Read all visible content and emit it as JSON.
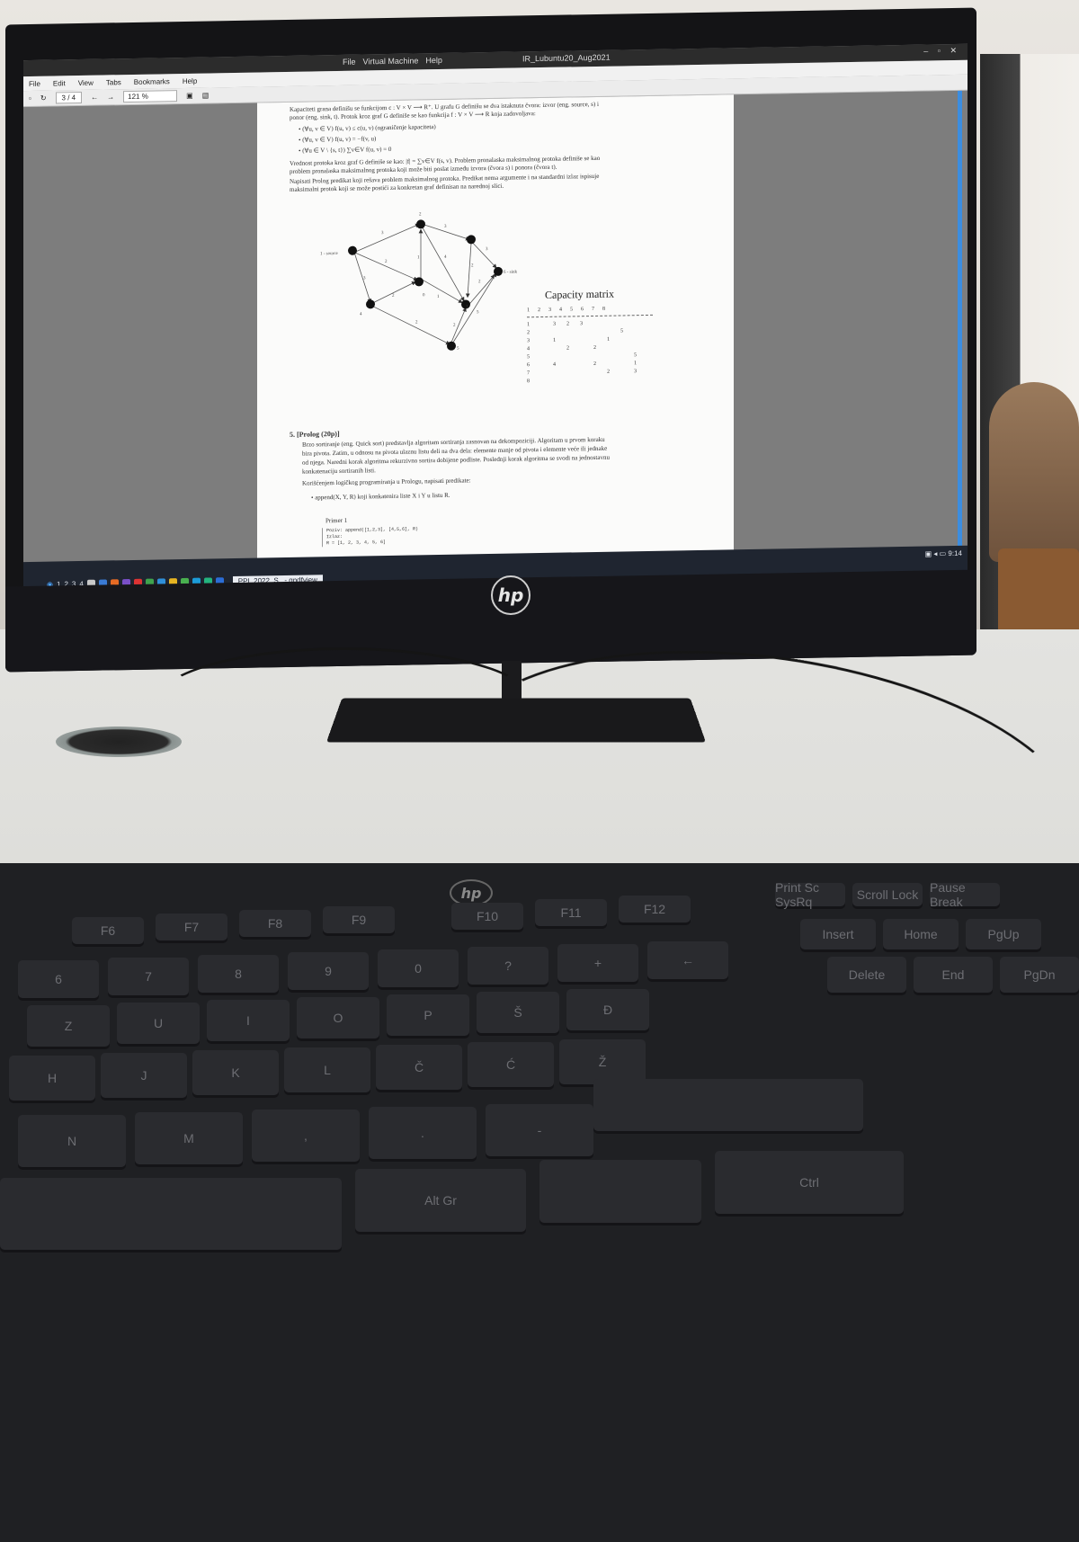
{
  "vm": {
    "menu": [
      "File",
      "Virtual Machine",
      "Help"
    ],
    "title": "IR_Lubuntu20_Aug2021"
  },
  "app": {
    "menu": [
      "File",
      "Edit",
      "View",
      "Tabs",
      "Bookmarks",
      "Help"
    ],
    "page_indicator": "3 / 4",
    "zoom": "121 %"
  },
  "document": {
    "intro_lines": [
      "Kapaciteti grana definišu se funkcijom c : V × V ⟶ R⁺. U grafu G definišu se dva istaknuta čvora: izvor (eng. source, s) i",
      "ponor (eng. sink, t). Protok kroz graf G definiše se kao funkcija f : V × V ⟶ R koja zadovoljava:"
    ],
    "bullets": [
      "(∀u, v ∈ V) f(u, v) ≤ c(u, v) (ograničenje kapaciteta)",
      "(∀u, v ∈ V) f(u, v) = −f(v, u)",
      "(∀u ∈ V \\ {s, t}) ∑v∈V f(u, v) = 0"
    ],
    "paragraph_lines": [
      "Vrednost protoka kroz graf G definiše se kao: |f| = ∑v∈V f(s, v). Problem pronalaska maksimalnog protoka definiše se kao",
      "problem pronalaska maksimalnog protoka koji može biti poslat između izvora (čvora s) i ponora (čvora t).",
      "Napisati Prolog predikat koji rešava problem maksimalnog protoka. Predikat nema argumente i na standardni izlaz ispisuje",
      "maksimalni protok koji se može postići za konkretan graf definisan na narednoj slici."
    ],
    "graph": {
      "source_label": "1 - source",
      "sink_label": "6 - sink",
      "edge_labels": [
        "3",
        "2",
        "3",
        "1",
        "2",
        "4",
        "3",
        "2",
        "0",
        "1",
        "4",
        "2",
        "1",
        "2",
        "5",
        "2",
        "3"
      ],
      "node_labels": [
        "2",
        "5"
      ]
    },
    "capacity_matrix": {
      "title": "Capacity matrix",
      "header": [
        "1",
        "2",
        "3",
        "4",
        "5",
        "6",
        "7",
        "8"
      ],
      "row_labels": [
        "1",
        "2",
        "3",
        "4",
        "5",
        "6",
        "7",
        "8"
      ],
      "rows": [
        [
          "",
          "3",
          "2",
          "3",
          "",
          "",
          "",
          ""
        ],
        [
          "",
          "",
          "",
          "",
          "",
          "",
          "5",
          ""
        ],
        [
          "",
          "1",
          "",
          "",
          "",
          "1",
          "",
          ""
        ],
        [
          "",
          "",
          "2",
          "",
          "2",
          "",
          "",
          ""
        ],
        [
          "",
          "",
          "",
          "",
          "",
          "",
          "",
          "5"
        ],
        [
          "",
          "4",
          "",
          "",
          "2",
          "",
          "",
          "1"
        ],
        [
          "",
          "",
          "",
          "",
          "",
          "2",
          "",
          "3"
        ],
        [
          "",
          "",
          "",
          "",
          "",
          "",
          "",
          ""
        ]
      ]
    },
    "section": {
      "heading": "5. [Prolog (20p)]",
      "lines": [
        "Brzo sortiranje (eng. Quick sort) predstavlja algoritam sortiranja zasnovan na dekompoziciji. Algoritam u prvom koraku",
        "bira pivota. Zatim, u odnosu na pivota ulaznu listu deli na dva dela: elemente manje od pivota i elemente veće ili jednake",
        "od njega. Naredni korak algoritma rekurzivno sortira dobijene podliste. Poslednji korak algoritma se svodi na jednostavnu",
        "konkatenaciju sortiranih listi."
      ],
      "task_line": "Korišćenjem logičkog programiranja u Prologu, napisati predikate:",
      "bullet": "append(X, Y, R) koji konkatenira liste X i Y u listu R.",
      "example_title": "Primer 1",
      "example_lines": [
        "Poziv: append([1,2,3], [4,5,6], R)",
        "Izlaz:",
        "R = [1, 2, 3, 4, 5, 6]"
      ]
    }
  },
  "taskbar": {
    "workspaces": [
      "1",
      "2",
      "3",
      "4"
    ],
    "active_window": "PPI_2022_S...- qpdfview",
    "clock": "9:14"
  },
  "keyboard": {
    "fkeys": [
      "F6",
      "F7",
      "F8",
      "F9",
      "F10",
      "F11",
      "F12"
    ],
    "system_keys": [
      "Print Sc SysRq",
      "Scroll Lock",
      "Pause Break",
      "Insert",
      "Home",
      "PgUp",
      "Delete",
      "End",
      "PgDn"
    ],
    "row_number": [
      "6",
      "7",
      "8",
      "9",
      "0",
      "?",
      "+",
      "←"
    ],
    "row_top": [
      "Z",
      "U",
      "I",
      "O",
      "P",
      "Š",
      "Đ"
    ],
    "row_home": [
      "H",
      "J",
      "K",
      "L",
      "Č",
      "Ć",
      "Ž"
    ],
    "row_bottom": [
      "N",
      "M",
      ",",
      ".",
      "-"
    ],
    "mods": [
      "Alt Gr",
      "Ctrl"
    ]
  },
  "colors": {
    "screen_bg": "#7d7d7d",
    "taskbar": "#1f2530",
    "scrollbar": "#3b8de0",
    "page": "#fbfbfa"
  }
}
